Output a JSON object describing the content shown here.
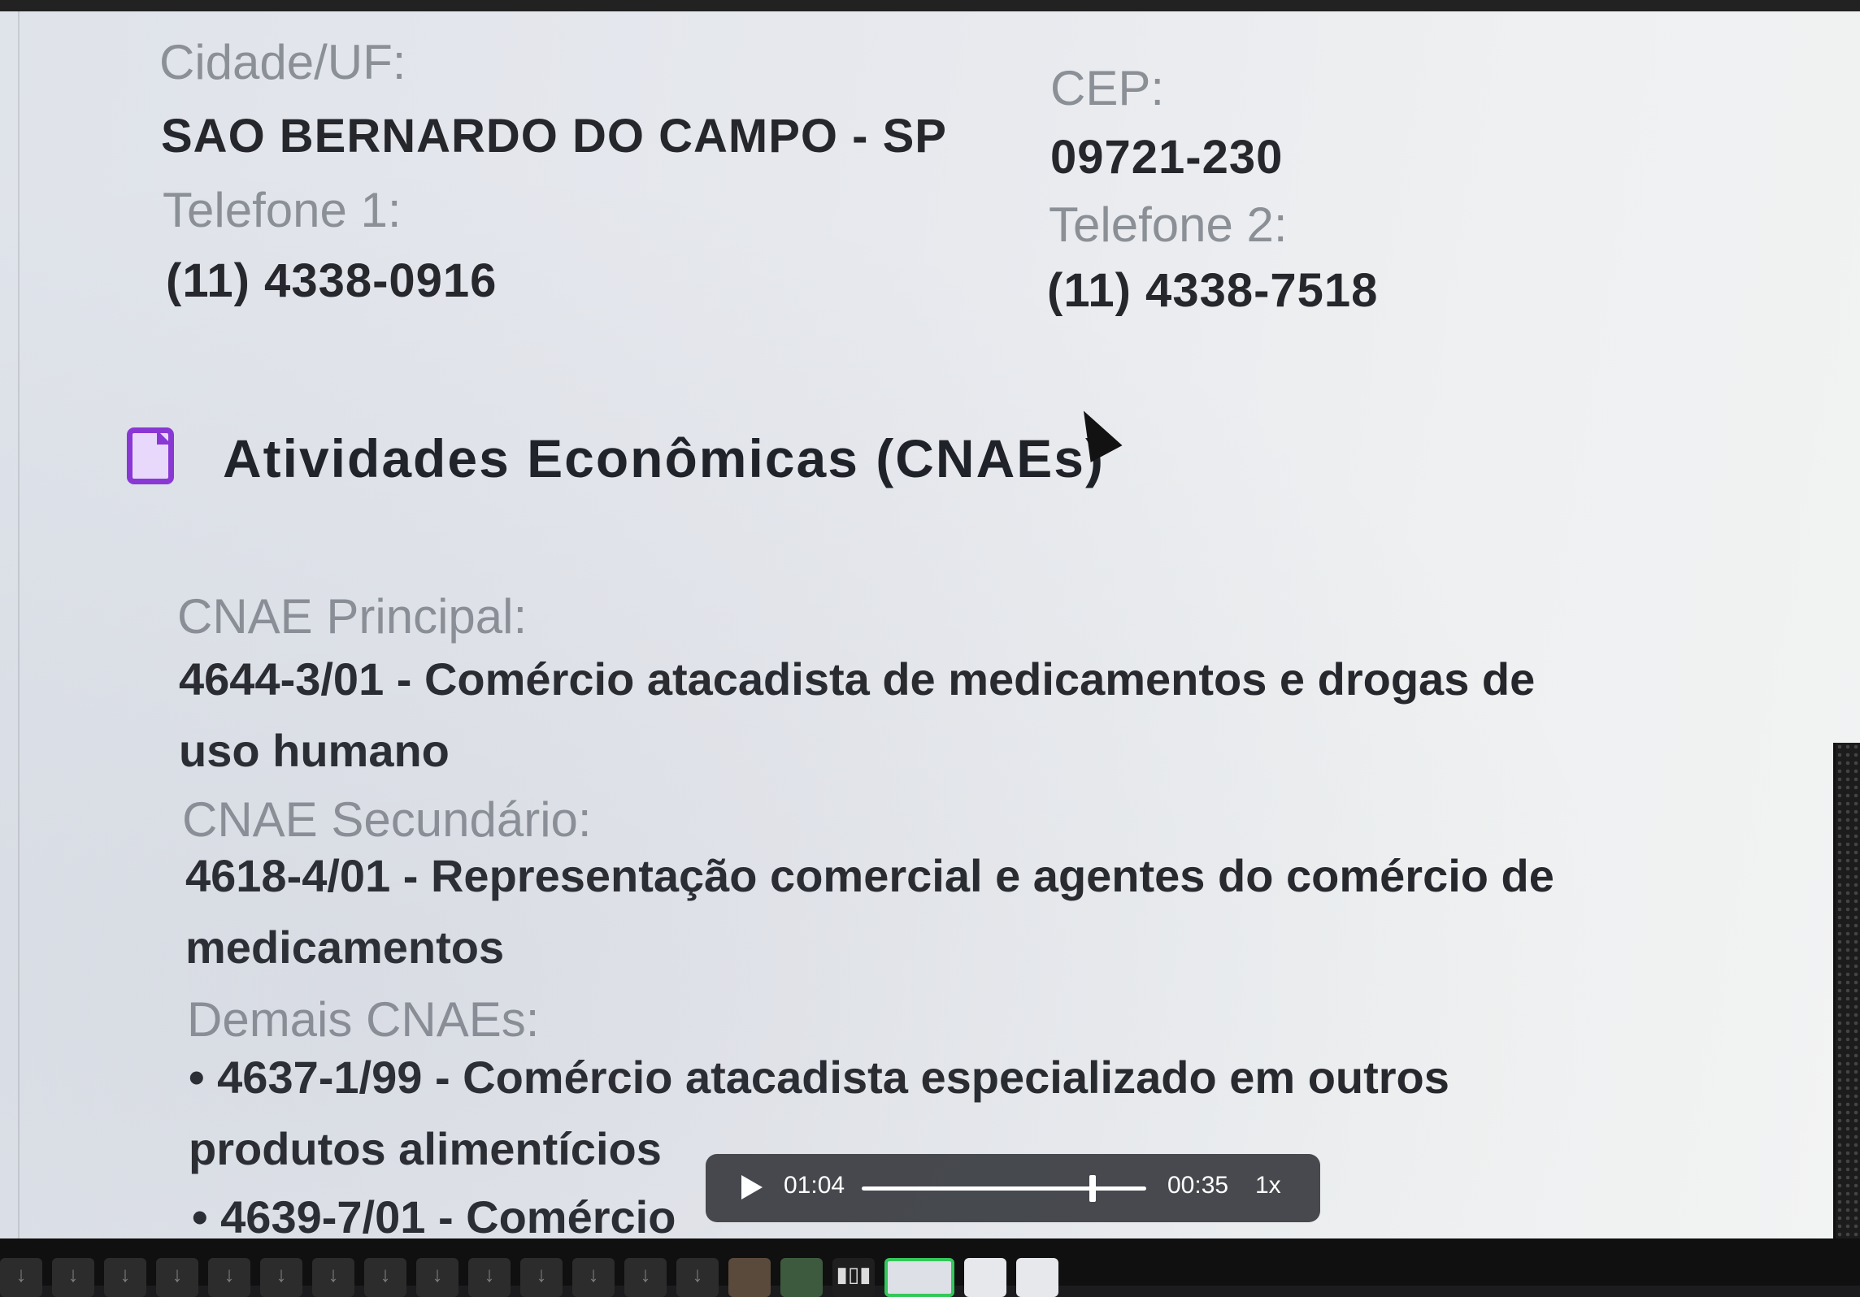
{
  "address": {
    "city_label": "Cidade/UF:",
    "city_value": "SAO BERNARDO DO CAMPO - SP",
    "cep_label": "CEP:",
    "cep_value": "09721-230",
    "phone1_label": "Telefone 1:",
    "phone1_value": "(11) 4338-0916",
    "phone2_label": "Telefone 2:",
    "phone2_value": "(11) 4338-7518"
  },
  "section": {
    "icon": "document-icon",
    "title": "Atividades Econômicas (CNAEs)"
  },
  "cnae": {
    "principal_label": "CNAE Principal:",
    "principal_value": "4644-3/01 - Comércio atacadista de medicamentos e drogas de uso humano",
    "secundario_label": "CNAE Secundário:",
    "secundario_value": "4618-4/01 - Representação comercial e agentes do comércio de medicamentos",
    "demais_label": "Demais CNAEs:",
    "demais_items": [
      "• 4637-1/99 - Comércio atacadista especializado em outros produtos alimentícios",
      "• 4639-7/01 - Comércio"
    ]
  },
  "video_controls": {
    "elapsed": "01:04",
    "remaining": "00:35",
    "speed": "1x",
    "progress": 0.82
  }
}
